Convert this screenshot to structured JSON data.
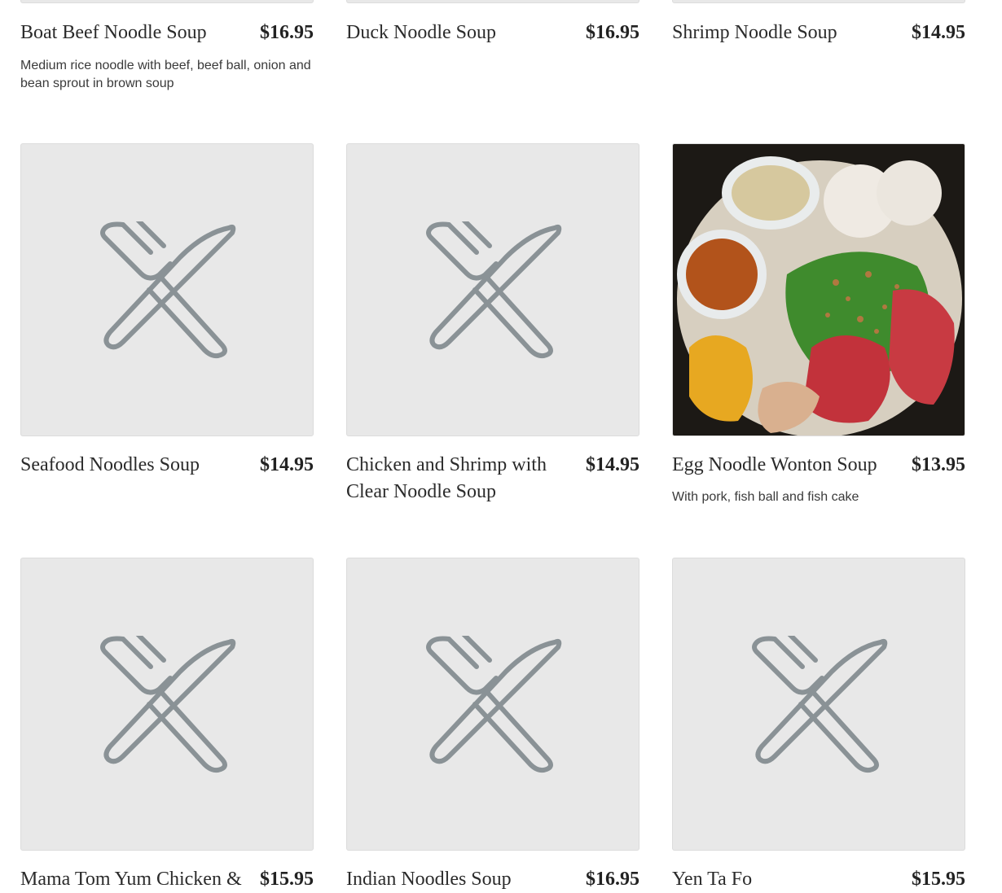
{
  "menu": {
    "items": [
      {
        "name": "Boat Beef Noodle Soup",
        "price": "$16.95",
        "description": "Medium rice noodle with beef, beef ball, onion and bean sprout in brown soup"
      },
      {
        "name": "Duck Noodle Soup",
        "price": "$16.95",
        "description": ""
      },
      {
        "name": "Shrimp Noodle Soup",
        "price": "$14.95",
        "description": ""
      },
      {
        "name": "Seafood Noodles Soup",
        "price": "$14.95",
        "description": ""
      },
      {
        "name": "Chicken and Shrimp with Clear Noodle Soup",
        "price": "$14.95",
        "description": ""
      },
      {
        "name": "Egg Noodle Wonton Soup",
        "price": "$13.95",
        "description": "With pork, fish ball and fish cake"
      },
      {
        "name": "Mama Tom Yum Chicken &",
        "price": "$15.95",
        "description": ""
      },
      {
        "name": "Indian Noodles Soup",
        "price": "$16.95",
        "description": ""
      },
      {
        "name": "Yen Ta Fo",
        "price": "$15.95",
        "description": ""
      }
    ]
  },
  "icons": {
    "placeholder": "fork-knife-icon"
  },
  "colors": {
    "placeholder_bg": "#e8e8e8",
    "placeholder_icon": "#8a9296"
  }
}
